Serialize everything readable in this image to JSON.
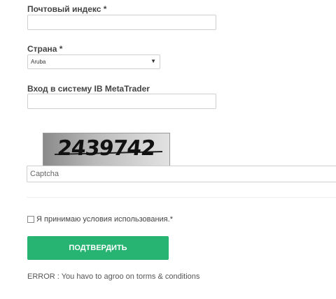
{
  "form": {
    "postal_code_label": "Почтовый индекс *",
    "postal_code_value": "",
    "country_label": "Страна *",
    "country_selected": "Aruba",
    "login_label": "Вход в систему IB MetaTrader",
    "login_value": "",
    "captcha_image_text": "2439742",
    "captcha_placeholder": "Captcha",
    "terms_label": "Я принимаю условия использования.*",
    "submit_label": "ПОДТВЕРДИТЬ",
    "error_message": "ERROR : You havo to agroo on torms & conditions"
  },
  "colors": {
    "submit_bg": "#27b372",
    "label_text": "#444444",
    "border": "#cfcfcf"
  },
  "icons": {
    "select_arrow": "chevron-down-icon"
  }
}
